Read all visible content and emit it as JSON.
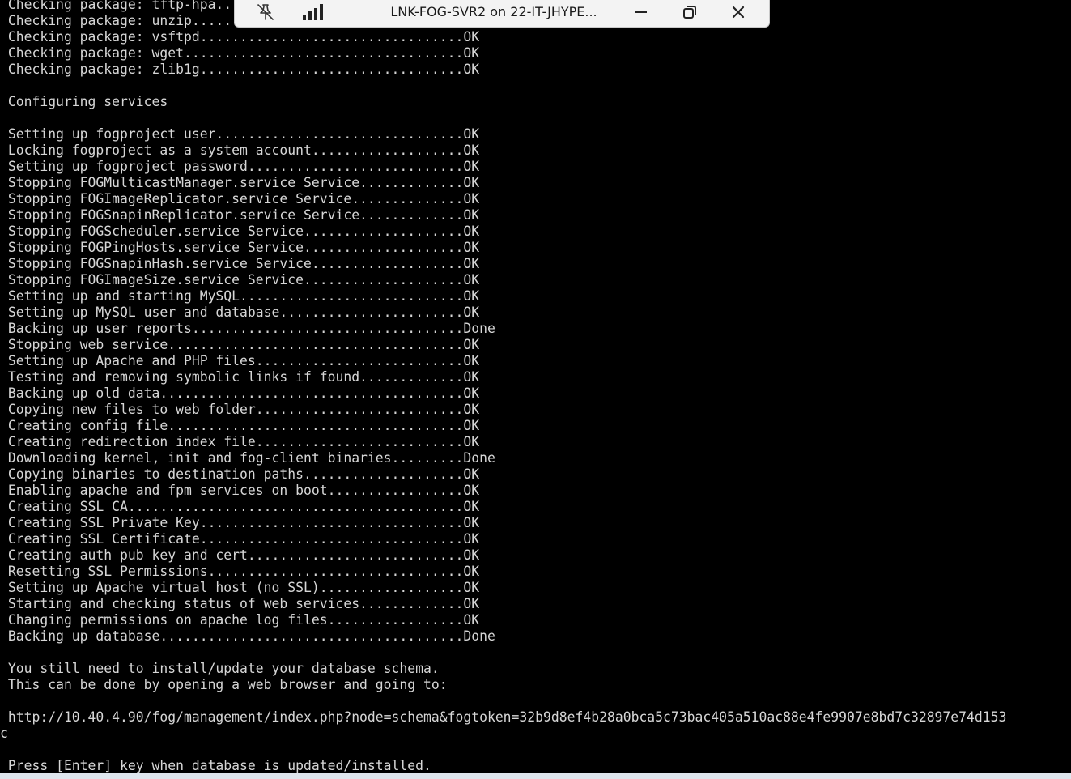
{
  "terminal": {
    "lines": [
      " Checking package: tftp-hpa..........................................OK",
      " Checking package: unzip.............................................OK",
      " Checking package: vsftpd.................................OK",
      " Checking package: wget...................................OK",
      " Checking package: zlib1g.................................OK",
      "",
      " Configuring services",
      "",
      " Setting up fogproject user...............................OK",
      " Locking fogproject as a system account...................OK",
      " Setting up fogproject password...........................OK",
      " Stopping FOGMulticastManager.service Service.............OK",
      " Stopping FOGImageReplicator.service Service..............OK",
      " Stopping FOGSnapinReplicator.service Service.............OK",
      " Stopping FOGScheduler.service Service....................OK",
      " Stopping FOGPingHosts.service Service....................OK",
      " Stopping FOGSnapinHash.service Service...................OK",
      " Stopping FOGImageSize.service Service....................OK",
      " Setting up and starting MySQL............................OK",
      " Setting up MySQL user and database.......................OK",
      " Backing up user reports..................................Done",
      " Stopping web service.....................................OK",
      " Setting up Apache and PHP files..........................OK",
      " Testing and removing symbolic links if found.............OK",
      " Backing up old data......................................OK",
      " Copying new files to web folder..........................OK",
      " Creating config file.....................................OK",
      " Creating redirection index file..........................OK",
      " Downloading kernel, init and fog-client binaries.........Done",
      " Copying binaries to destination paths....................OK",
      " Enabling apache and fpm services on boot.................OK",
      " Creating SSL CA..........................................OK",
      " Creating SSL Private Key.................................OK",
      " Creating SSL Certificate.................................OK",
      " Creating auth pub key and cert...........................OK",
      " Resetting SSL Permissions................................OK",
      " Setting up Apache virtual host (no SSL)..................OK",
      " Starting and checking status of web services.............OK",
      " Changing permissions on apache log files.................OK",
      " Backing up database......................................Done",
      "",
      " You still need to install/update your database schema.",
      " This can be done by opening a web browser and going to:",
      "",
      " http://10.40.4.90/fog/management/index.php?node=schema&fogtoken=32b9d8ef4b28a0bca5c73bac405a510ac88e4fe9907e8bd7c32897e74d153",
      "c",
      "",
      " Press [Enter] key when database is updated/installed."
    ]
  },
  "connection_bar": {
    "title": "LNK-FOG-SVR2 on 22-IT-JHYPE...",
    "pin_icon": "unpin-icon",
    "signal_icon": "signal-strength-icon",
    "minimize_icon": "minimize-icon",
    "restore_icon": "restore-icon",
    "close_icon": "close-icon"
  },
  "colors": {
    "terminal_background": "#000000",
    "terminal_text": "#d6d6d6",
    "bar_background": "#f3f3f3"
  }
}
